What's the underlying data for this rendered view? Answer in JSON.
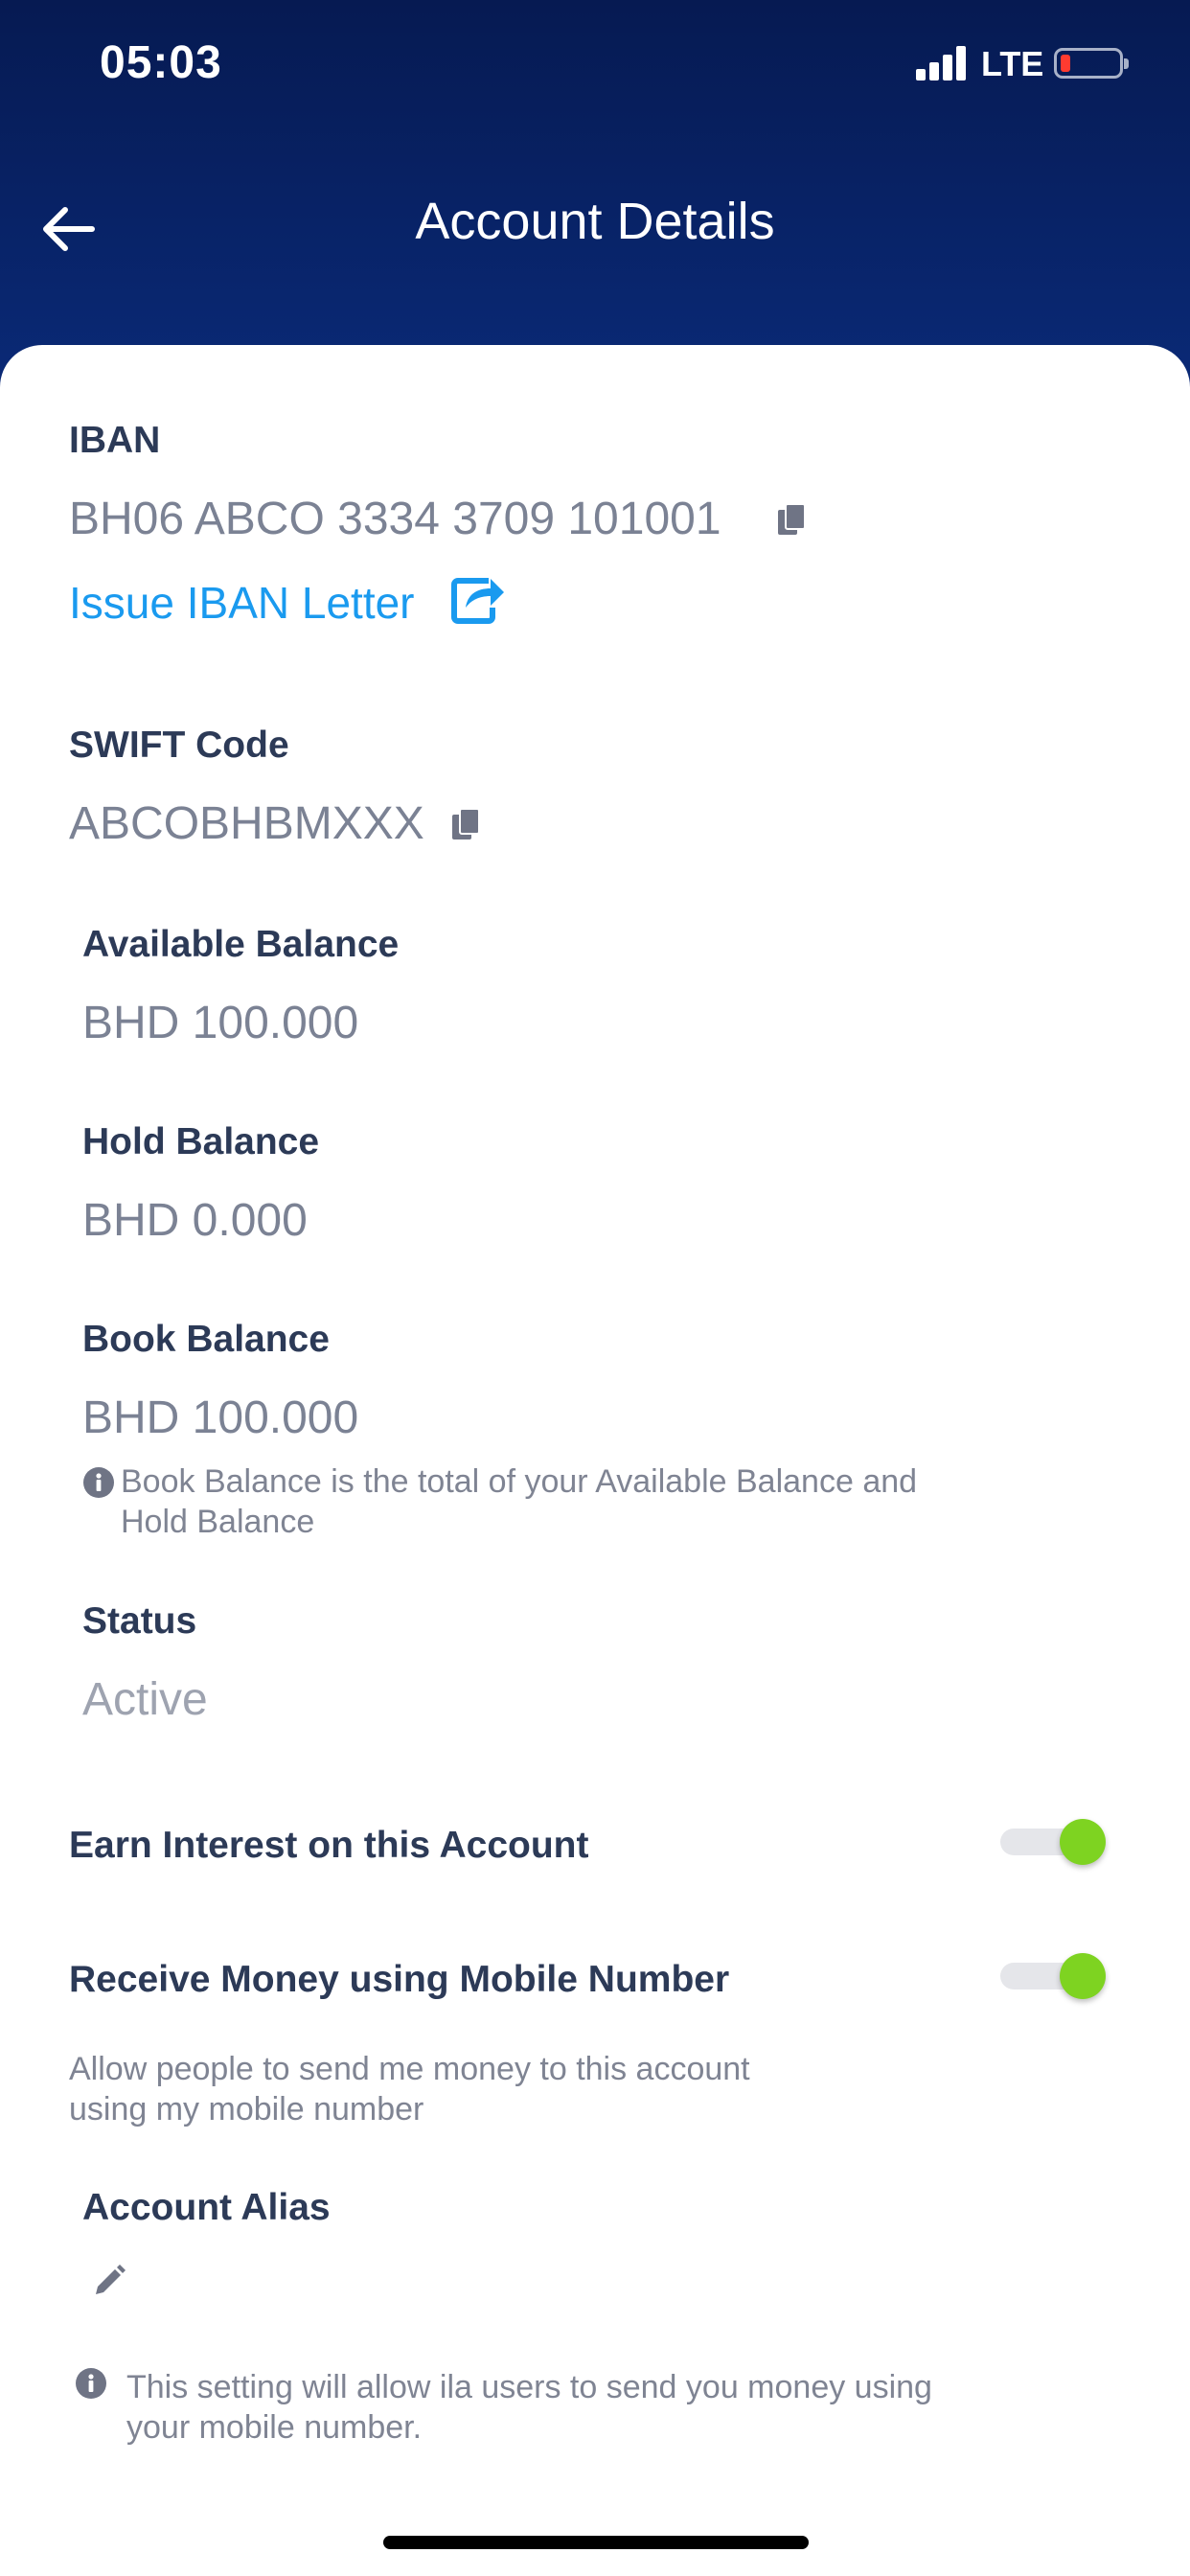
{
  "status_bar": {
    "time": "05:03",
    "network": "LTE",
    "battery_color": "#ff3b30"
  },
  "header": {
    "title": "Account Details",
    "back_icon": "arrow-left-icon",
    "bg_color": "#061a52"
  },
  "iban": {
    "label": "IBAN",
    "value": "BH06 ABCO 3334 3709 101001",
    "issue_link": "Issue IBAN Letter"
  },
  "swift": {
    "label": "SWIFT Code",
    "value": "ABCOBHBMXXX"
  },
  "available_balance": {
    "label": "Available Balance",
    "value": "BHD 100.000"
  },
  "hold_balance": {
    "label": "Hold Balance",
    "value": "BHD 0.000"
  },
  "book_balance": {
    "label": "Book Balance",
    "value": "BHD 100.000",
    "note_line1": "Book Balance is the total of your Available Balance and",
    "note_line2": "Hold Balance"
  },
  "status": {
    "label": "Status",
    "value": "Active"
  },
  "earn_interest": {
    "label": "Earn Interest on this Account",
    "enabled": true
  },
  "receive_money": {
    "label": "Receive Money using Mobile Number",
    "enabled": true,
    "desc_line1": "Allow people to send me money to this account",
    "desc_line2": "using my mobile number"
  },
  "account_alias": {
    "label": "Account Alias"
  },
  "footer_note": {
    "line1": "This setting will allow ila users to send you money using",
    "line2": "your mobile number."
  },
  "colors": {
    "accent": "#1a9aef",
    "toggle_on": "#7ed321",
    "label": "#2c3a57",
    "value": "#7b8294"
  }
}
